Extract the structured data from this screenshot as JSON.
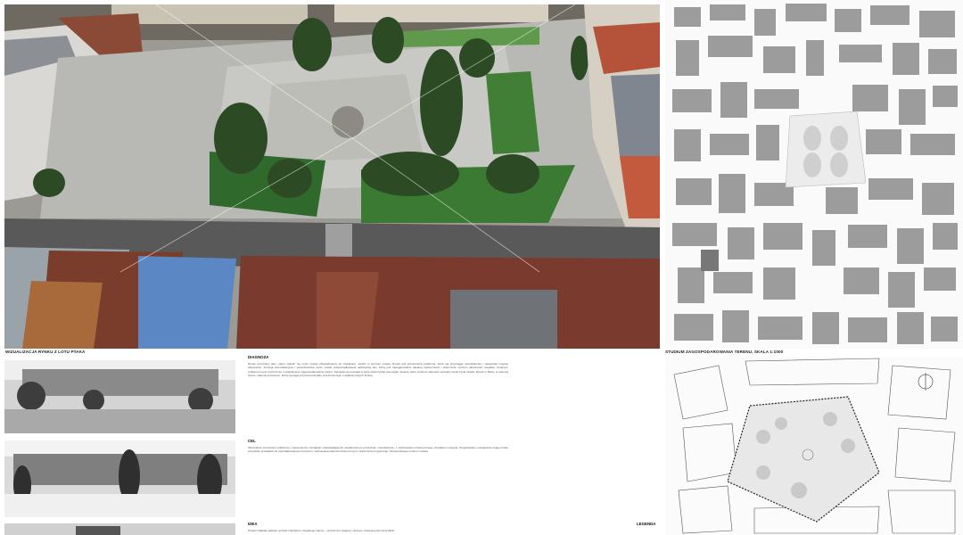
{
  "captions": {
    "render": "WIZUALIZACJA RYNKU Z LOTU PTAKA",
    "study": "STUDIUM ZAGOSPODAROWANIA TERENU, SKALA 1:1000"
  },
  "sections": {
    "diagnoza": {
      "title": "DIAGNOZA",
      "body": "Rynek rozumiany jako „salon miasta” nie może zostać zdegradowany do charakteru „węzła” w centrum miasta. Rynek jest przestrzenią publiczną, która ma przyciągać mieszkańców i zapewniać miejsca aktywności. Funkcja komunikacyjna i samochodowa może zostać podporządkowana nadrzędnej idei, którą jest zaangażowanie lokalnej społeczności i stworzenie centrum aktywności miejskiej. Kolejnym problemem jest zniszczenie i nieefektywne zagospodarowanie zieleni. Sytuacja nie pozwala w pełni wykorzystać potencjału miejsca, które powinno stanowić centralny punkt życia miasta. Rynek w Słoku, w obecnej formie, stanowi przestrzeń, która wymaga przywrócenia ładu przestrzennego i nadania nowych funkcji."
    },
    "cel": {
      "title": "CEL",
      "body": "Wzrastanie przestrzeni publicznej i zapewnienie rozwiązań odpowiadających współczesnym potrzebom mieszkańców, z zachowaniem historycznego charakteru miejsca. Projektowane rozwiązania mają przede wszystkim prowadzić do uporządkowania przestrzeni, zachowania walorów historycznych i stworzenia przyjaznego, funkcjonalnego centrum miasta."
    },
    "idea": {
      "title": "IDEA",
      "body": "Projekt zakłada nadanie rynkowi charakteru miejskiego salonu – przestrzeni otwartej, zielonej i dostępnej dla wszystkich."
    }
  },
  "legend": {
    "title": "LEGENDA"
  }
}
